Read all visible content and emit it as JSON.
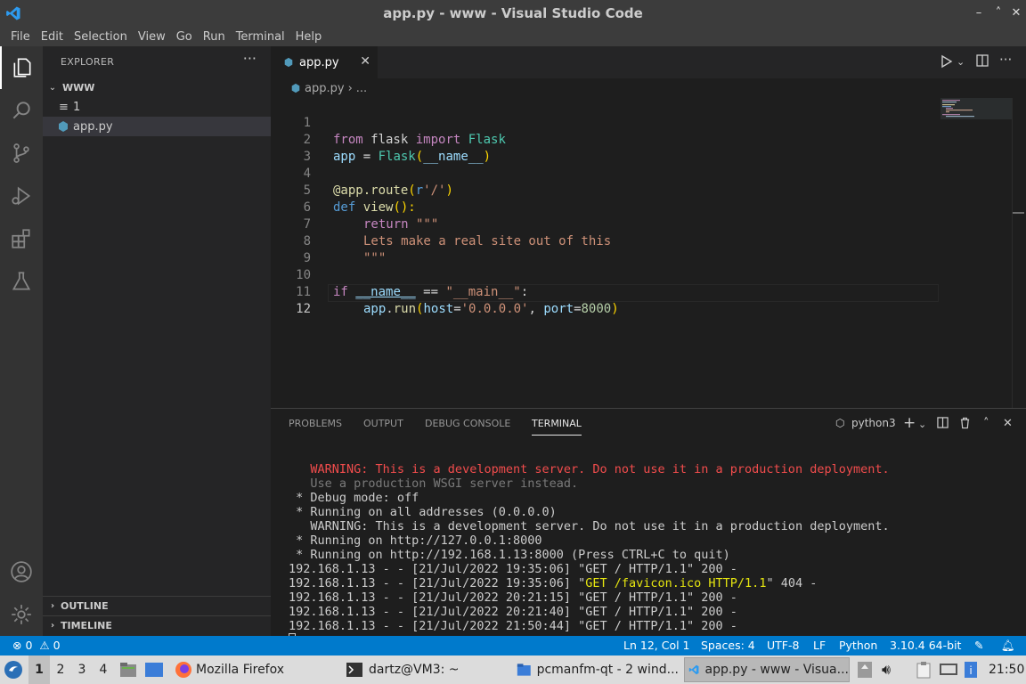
{
  "window": {
    "title": "app.py - www - Visual Studio Code",
    "controls": {
      "minimize": "–",
      "restore": "˄",
      "maximize": "▫",
      "close": "✕"
    }
  },
  "menu": [
    "File",
    "Edit",
    "Selection",
    "View",
    "Go",
    "Run",
    "Terminal",
    "Help"
  ],
  "activity_bar": [
    "explorer-icon",
    "search-icon",
    "source-control-icon",
    "run-debug-icon",
    "extensions-icon",
    "testing-icon",
    "account-icon",
    "manage-gear-icon"
  ],
  "sidebar": {
    "title": "EXPLORER",
    "more": "···",
    "folder": "WWW",
    "files": [
      {
        "name": "1",
        "icon": "text-file-icon"
      },
      {
        "name": "app.py",
        "icon": "python-file-icon"
      }
    ],
    "outline": "OUTLINE",
    "timeline": "TIMELINE"
  },
  "editor": {
    "tab_label": "app.py",
    "tab_close": "✕",
    "breadcrumb_file": "app.py",
    "breadcrumb_sep": "›",
    "breadcrumb_more": "...",
    "line_numbers": [
      "1",
      "2",
      "3",
      "4",
      "5",
      "6",
      "7",
      "8",
      "9",
      "10",
      "11",
      "12"
    ],
    "code": {
      "l1": {
        "a": "from",
        "b": " flask ",
        "c": "import",
        "d": " Flask"
      },
      "l2": {
        "a": "app",
        "b": " = ",
        "c": "Flask",
        "d": "(",
        "e": "__name__",
        "f": ")"
      },
      "l4": {
        "a": "@app.route",
        "b": "(",
        "c": "r",
        "d": "'/'",
        "e": ")"
      },
      "l5": {
        "a": "def",
        "b": " ",
        "c": "view",
        "d": "():"
      },
      "l6": {
        "a": "return",
        "b": " \"\"\""
      },
      "l7": "Lets make a real site out of this",
      "l8": "\"\"\"",
      "l10": {
        "a": "if",
        "b": " ",
        "c": "__name__",
        "d": " == ",
        "e": "\"__main__\"",
        "f": ":"
      },
      "l11": {
        "a": "app",
        "b": ".",
        "c": "run",
        "d": "(",
        "e": "host",
        "f": "=",
        "g": "'0.0.0.0'",
        "h": ", ",
        "i": "port",
        "j": "=",
        "k": "8000",
        "l": ")"
      }
    }
  },
  "panel": {
    "tabs": [
      "PROBLEMS",
      "OUTPUT",
      "DEBUG CONSOLE",
      "TERMINAL"
    ],
    "active_tab": "TERMINAL",
    "shell": "python3",
    "terminal_lines": [
      {
        "text": "   WARNING: This is a development server. Do not use it in a production deployment.",
        "style": "red"
      },
      {
        "text": "   Use a production WSGI server instead.",
        "style": "dim"
      },
      {
        "text": " * Debug mode: off",
        "style": "normal"
      },
      {
        "text": " * Running on all addresses (0.0.0.0)",
        "style": "normal"
      },
      {
        "text": "   WARNING: This is a development server. Do not use it in a production deployment.",
        "style": "normal"
      },
      {
        "text": " * Running on http://127.0.0.1:8000",
        "style": "normal"
      },
      {
        "text": " * Running on http://192.168.1.13:8000 (Press CTRL+C to quit)",
        "style": "normal"
      },
      {
        "text": "192.168.1.13 - - [21/Jul/2022 19:35:06] \"GET / HTTP/1.1\" 200 -",
        "style": "normal"
      },
      {
        "pre": "192.168.1.13 - - [21/Jul/2022 19:35:06] \"",
        "hl": "GET /favicon.ico HTTP/1.1",
        "post": "\" 404 -",
        "style": "split"
      },
      {
        "text": "192.168.1.13 - - [21/Jul/2022 20:21:15] \"GET / HTTP/1.1\" 200 -",
        "style": "normal"
      },
      {
        "text": "192.168.1.13 - - [21/Jul/2022 20:21:40] \"GET / HTTP/1.1\" 200 -",
        "style": "normal"
      },
      {
        "text": "192.168.1.13 - - [21/Jul/2022 21:50:44] \"GET / HTTP/1.1\" 200 -",
        "style": "normal"
      }
    ]
  },
  "status_bar": {
    "errors": "0",
    "warnings": "0",
    "cursor": "Ln 12, Col 1",
    "spaces": "Spaces: 4",
    "encoding": "UTF-8",
    "eol": "LF",
    "language": "Python",
    "interpreter": "3.10.4 64-bit"
  },
  "taskbar": {
    "desktops": [
      "1",
      "2",
      "3",
      "4"
    ],
    "tasks": [
      {
        "label": "Mozilla Firefox",
        "icon": "firefox-icon"
      },
      {
        "label": "dartz@VM3: ~",
        "icon": "terminal-icon"
      },
      {
        "label": "pcmanfm-qt - 2 wind...",
        "icon": "folder-icon"
      },
      {
        "label": "app.py - www - Visua...",
        "icon": "vscode-icon"
      }
    ],
    "clock": "21:50"
  },
  "colors": {
    "accent": "#007acc",
    "titlebar": "#3c3c3c",
    "sidebar": "#252526",
    "editor_bg": "#1e1e1e"
  }
}
